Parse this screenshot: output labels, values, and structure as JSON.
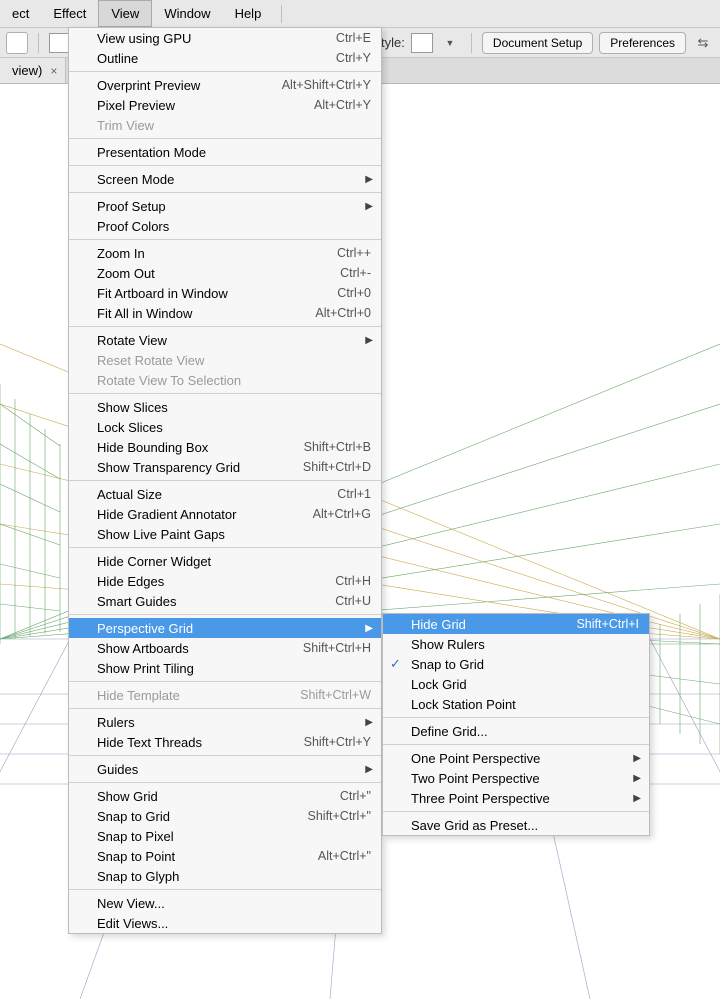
{
  "menubar": {
    "items": [
      "ect",
      "Effect",
      "View",
      "Window",
      "Help"
    ],
    "active_index": 2
  },
  "toolbar": {
    "style_label": "Style:",
    "doc_setup": "Document Setup",
    "prefs": "Preferences"
  },
  "doc_tab": {
    "title": "view)",
    "close": "×"
  },
  "view_menu": {
    "groups": [
      [
        {
          "label": "View using GPU",
          "shortcut": "Ctrl+E"
        },
        {
          "label": "Outline",
          "shortcut": "Ctrl+Y"
        }
      ],
      [
        {
          "label": "Overprint Preview",
          "shortcut": "Alt+Shift+Ctrl+Y"
        },
        {
          "label": "Pixel Preview",
          "shortcut": "Alt+Ctrl+Y"
        },
        {
          "label": "Trim View",
          "disabled": true
        }
      ],
      [
        {
          "label": "Presentation Mode"
        }
      ],
      [
        {
          "label": "Screen Mode",
          "submenu": true
        }
      ],
      [
        {
          "label": "Proof Setup",
          "submenu": true
        },
        {
          "label": "Proof Colors"
        }
      ],
      [
        {
          "label": "Zoom In",
          "shortcut": "Ctrl++"
        },
        {
          "label": "Zoom Out",
          "shortcut": "Ctrl+-"
        },
        {
          "label": "Fit Artboard in Window",
          "shortcut": "Ctrl+0"
        },
        {
          "label": "Fit All in Window",
          "shortcut": "Alt+Ctrl+0"
        }
      ],
      [
        {
          "label": "Rotate View",
          "submenu": true
        },
        {
          "label": "Reset Rotate View",
          "disabled": true
        },
        {
          "label": "Rotate View To Selection",
          "disabled": true
        }
      ],
      [
        {
          "label": "Show Slices"
        },
        {
          "label": "Lock Slices"
        },
        {
          "label": "Hide Bounding Box",
          "shortcut": "Shift+Ctrl+B"
        },
        {
          "label": "Show Transparency Grid",
          "shortcut": "Shift+Ctrl+D"
        }
      ],
      [
        {
          "label": "Actual Size",
          "shortcut": "Ctrl+1"
        },
        {
          "label": "Hide Gradient Annotator",
          "shortcut": "Alt+Ctrl+G"
        },
        {
          "label": "Show Live Paint Gaps"
        }
      ],
      [
        {
          "label": "Hide Corner Widget"
        },
        {
          "label": "Hide Edges",
          "shortcut": "Ctrl+H"
        },
        {
          "label": "Smart Guides",
          "shortcut": "Ctrl+U"
        }
      ],
      [
        {
          "label": "Perspective Grid",
          "submenu": true,
          "highlight": true
        },
        {
          "label": "Show Artboards",
          "shortcut": "Shift+Ctrl+H"
        },
        {
          "label": "Show Print Tiling"
        }
      ],
      [
        {
          "label": "Hide Template",
          "shortcut": "Shift+Ctrl+W",
          "disabled": true
        }
      ],
      [
        {
          "label": "Rulers",
          "submenu": true
        },
        {
          "label": "Hide Text Threads",
          "shortcut": "Shift+Ctrl+Y"
        }
      ],
      [
        {
          "label": "Guides",
          "submenu": true
        }
      ],
      [
        {
          "label": "Show Grid",
          "shortcut": "Ctrl+\""
        },
        {
          "label": "Snap to Grid",
          "shortcut": "Shift+Ctrl+\""
        },
        {
          "label": "Snap to Pixel"
        },
        {
          "label": "Snap to Point",
          "shortcut": "Alt+Ctrl+\""
        },
        {
          "label": "Snap to Glyph"
        }
      ],
      [
        {
          "label": "New View..."
        },
        {
          "label": "Edit Views..."
        }
      ]
    ]
  },
  "perspective_submenu": {
    "groups": [
      [
        {
          "label": "Hide Grid",
          "shortcut": "Shift+Ctrl+I",
          "highlight": true
        },
        {
          "label": "Show Rulers"
        },
        {
          "label": "Snap to Grid",
          "checked": true
        },
        {
          "label": "Lock Grid"
        },
        {
          "label": "Lock Station Point"
        }
      ],
      [
        {
          "label": "Define Grid..."
        }
      ],
      [
        {
          "label": "One Point Perspective",
          "submenu": true
        },
        {
          "label": "Two Point Perspective",
          "submenu": true
        },
        {
          "label": "Three Point Perspective",
          "submenu": true
        }
      ],
      [
        {
          "label": "Save Grid as Preset..."
        }
      ]
    ]
  }
}
